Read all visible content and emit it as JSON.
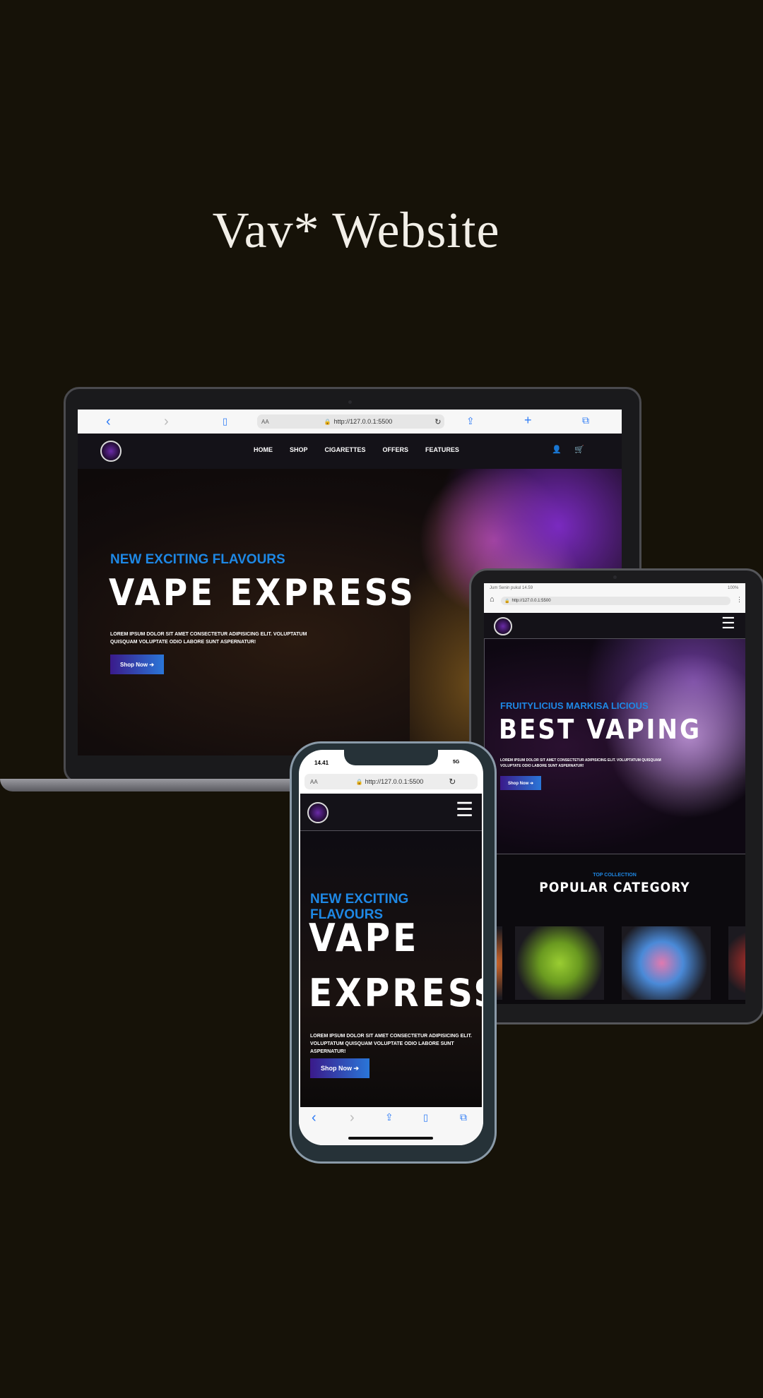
{
  "page": {
    "title": "Vav* Website"
  },
  "laptop": {
    "url": "http://127.0.0.1:5500",
    "text_size": "AA",
    "nav": [
      "HOME",
      "SHOP",
      "CIGARETTES",
      "OFFERS",
      "FEATURES"
    ],
    "hero": {
      "kicker": "NEW EXCITING FLAVOURS",
      "headline": "VAPE EXPRESS",
      "body": "LOREM IPSUM DOLOR SIT AMET CONSECTETUR ADIPISICING ELIT. VOLUPTATUM QUISQUAM VOLUPTATE ODIO LABORE SUNT ASPERNATUR!",
      "cta": "Shop Now ➔"
    }
  },
  "tablet": {
    "status_time": "Jum Senin pukul 14.59",
    "battery": "100%",
    "url": "http://127.0.0.1:5500",
    "hero": {
      "kicker": "FRUITYLICIUS MARKISA LICIOUS",
      "headline": "BEST VAPING",
      "body": "LOREM IPSUM DOLOR SIT AMET CONSECTETUR ADIPISICING ELIT. VOLUPTATUM QUISQUAM VOLUPTATE ODIO LABORE SUNT ASPERNATUR!",
      "cta": "Shop Now ➔"
    },
    "collection": {
      "kicker": "TOP COLLECTION",
      "title": "POPULAR CATEGORY"
    }
  },
  "phone": {
    "status_time": "14.41",
    "network": "5G",
    "text_size": "AA",
    "url": "http://127.0.0.1:5500",
    "hero": {
      "kicker": "NEW EXCITING FLAVOURS",
      "headline_line1": "VAPE",
      "headline_line2": "EXPRESS",
      "body": "LOREM IPSUM DOLOR SIT AMET CONSECTETUR ADIPISICING ELIT. VOLUPTATUM QUISQUAM VOLUPTATE ODIO LABORE SUNT ASPERNATUR!",
      "cta": "Shop Now ➔"
    }
  },
  "icons": {
    "back": "‹",
    "forward": "›",
    "bookmark": "▯",
    "share": "⇪",
    "plus": "+",
    "tabs": "⧉",
    "reload": "↻",
    "lock": "🔒",
    "user": "👤",
    "cart": "🛒",
    "menu": "☰",
    "home": "⌂"
  },
  "colors": {
    "accent_blue": "#1e88e5",
    "cta_start": "#3a1a8a",
    "cta_end": "#2a76d8",
    "background": "#161208"
  }
}
